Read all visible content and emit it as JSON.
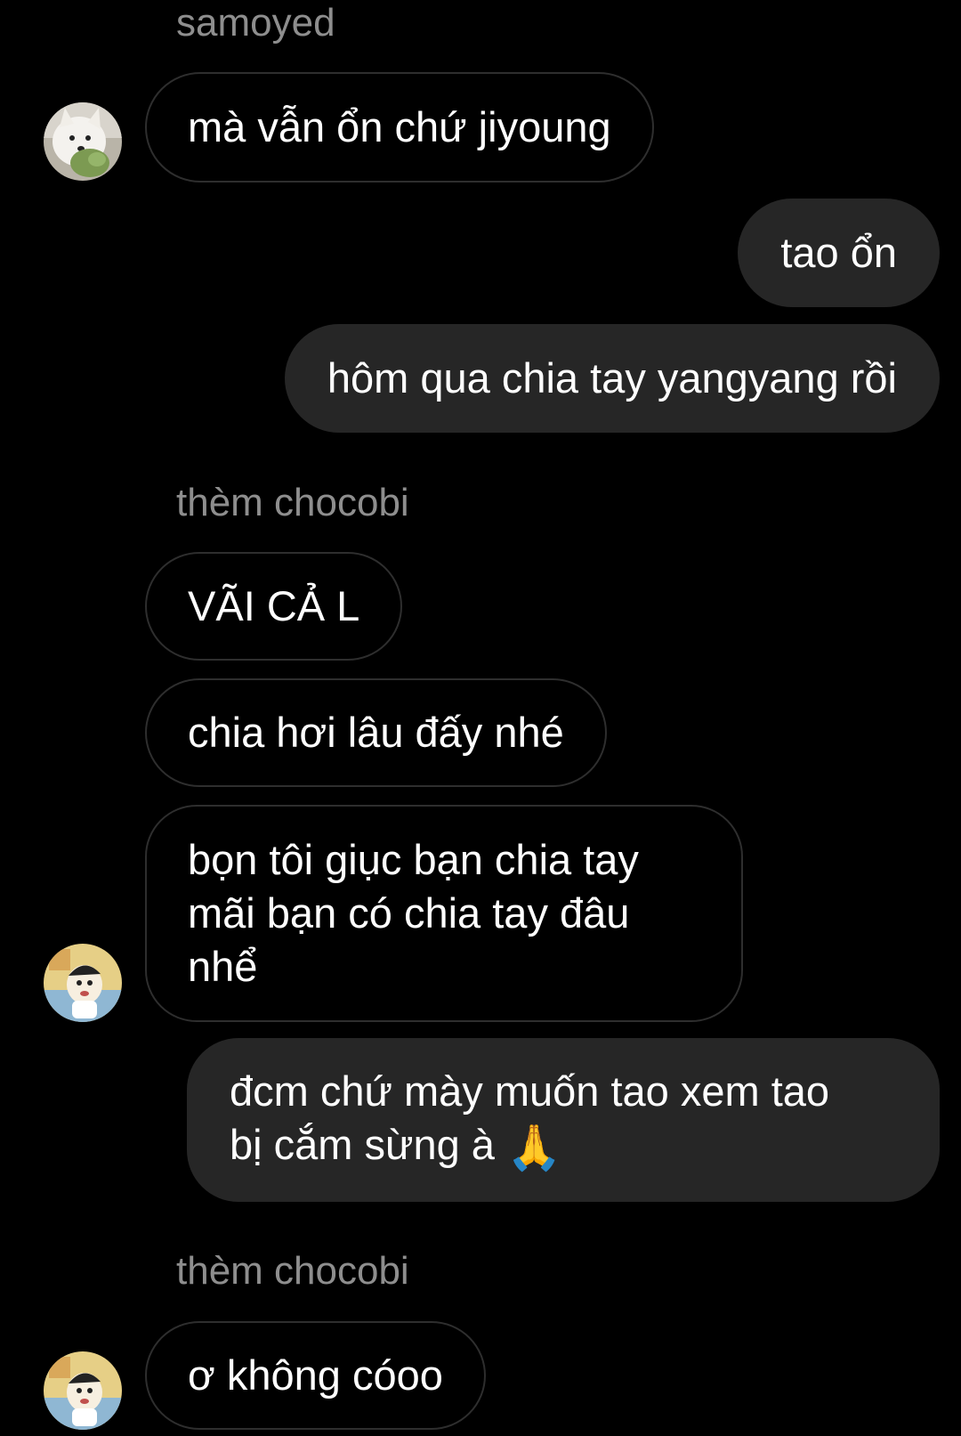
{
  "messages": [
    {
      "sender": "samoyed"
    },
    {
      "text": "mà vẫn ổn chứ jiyoung"
    },
    {
      "text": "tao ổn"
    },
    {
      "text": "hôm qua chia tay yangyang rồi"
    },
    {
      "sender": "thèm chocobi"
    },
    {
      "text": "VÃI CẢ L"
    },
    {
      "text": "chia hơi lâu đấy nhé"
    },
    {
      "lines": [
        "bọn tôi giục bạn chia tay",
        "mãi bạn có chia tay đâu",
        "nhể"
      ]
    },
    {
      "lines": [
        "đcm chứ mày muốn tao xem tao",
        "bị cắm sừng à"
      ],
      "emoji": "🙏"
    },
    {
      "sender": "thèm chocobi"
    },
    {
      "text": "ơ không cóoo"
    }
  ],
  "colors": {
    "background": "#000000",
    "sender_name": "#8e8e8e",
    "outgoing_bubble": "#262626",
    "incoming_border": "#2e2e2e"
  }
}
